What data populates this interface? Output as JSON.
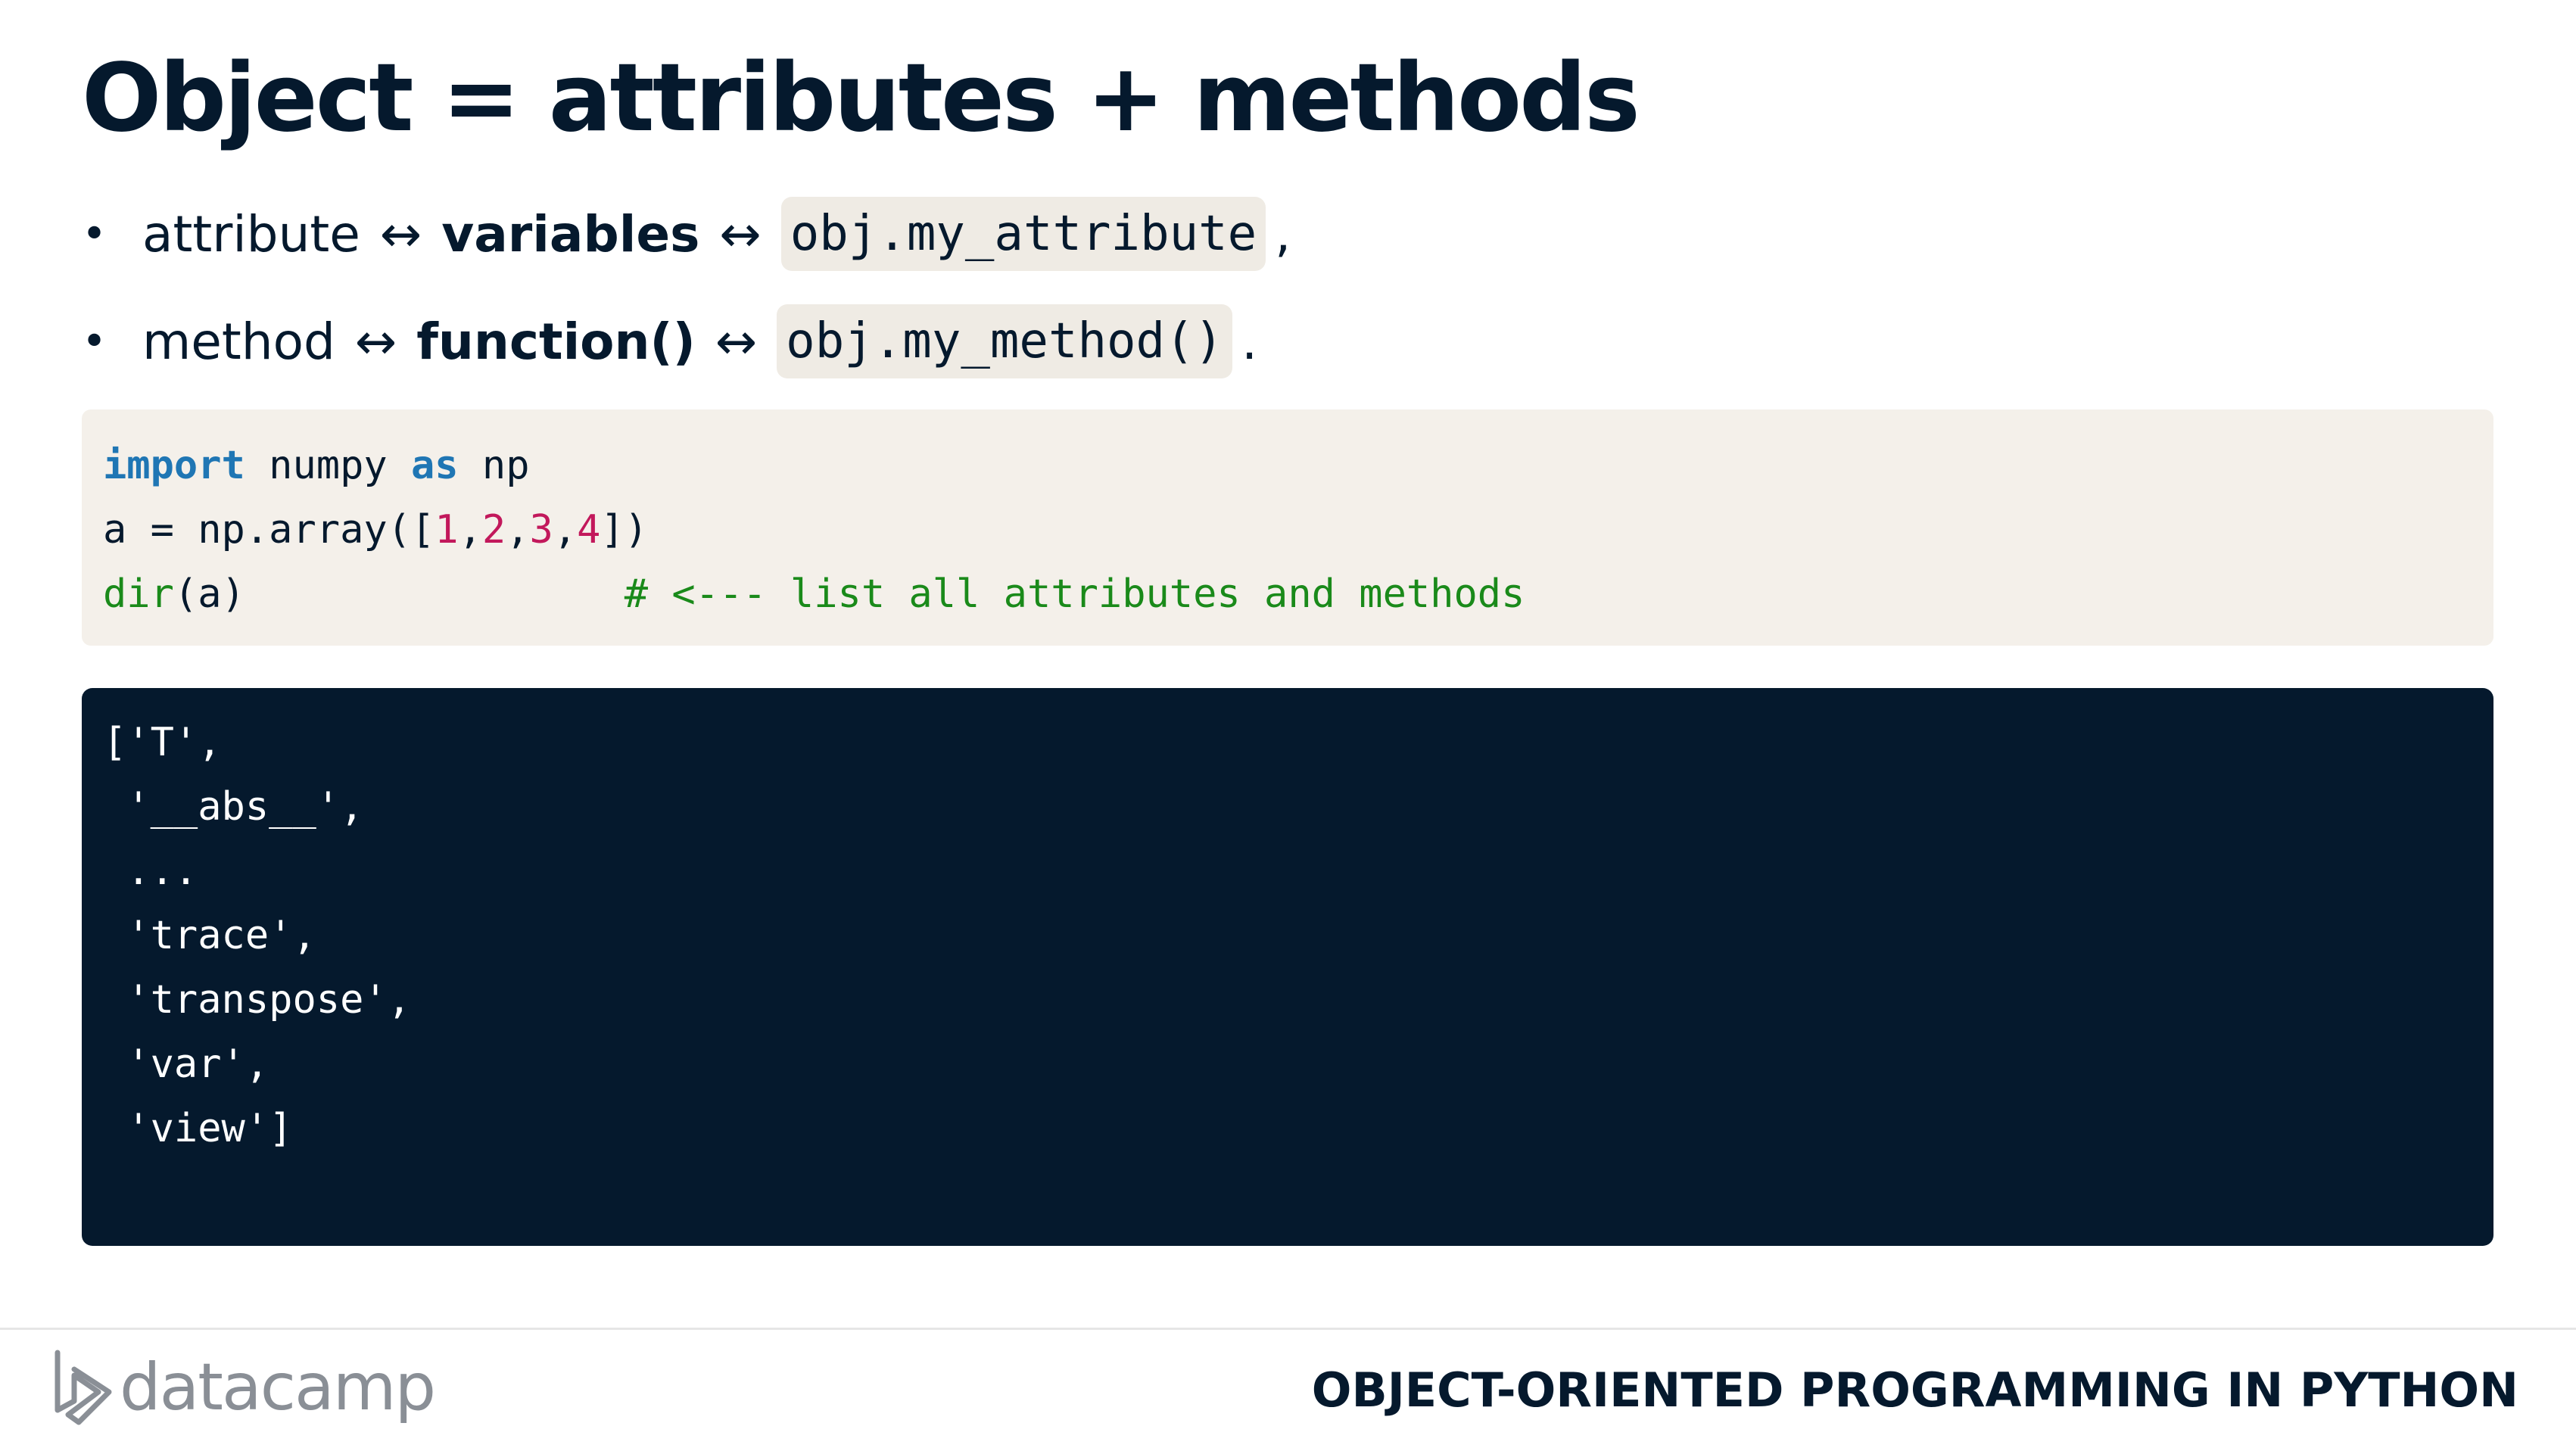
{
  "slide": {
    "title": "Object = attributes + methods"
  },
  "bullets": [
    {
      "term": "attribute",
      "arrow1": "↔",
      "bold": "variables",
      "arrow2": "↔",
      "code": "obj.my_attribute",
      "trail": ","
    },
    {
      "term": "method",
      "arrow1": "↔",
      "bold": "function()",
      "arrow2": "↔",
      "code": "obj.my_method()",
      "trail": "."
    }
  ],
  "code_input": {
    "line1": {
      "kw1": "import",
      "t1": " numpy ",
      "kw2": "as",
      "t2": " np"
    },
    "line2": {
      "p0": "a = np.array([",
      "n1": "1",
      "c1": ",",
      "n2": "2",
      "c2": ",",
      "n3": "3",
      "c3": ",",
      "n4": "4",
      "p1": "])"
    },
    "line3": {
      "fn": "dir",
      "arg": "(a)",
      "pad": "                ",
      "comment": "# <--- list all attributes and methods"
    }
  },
  "code_output": {
    "lines": [
      "['T',",
      " '__abs__',",
      " ...",
      " 'trace',",
      " 'transpose',",
      " 'var',",
      " 'view']"
    ]
  },
  "footer": {
    "logo_text": "datacamp",
    "course": "OBJECT-ORIENTED PROGRAMMING IN PYTHON"
  },
  "colors": {
    "navy": "#05192d",
    "keyword": "#1f76b4",
    "number": "#c2185b",
    "comment": "#1a8a1a",
    "code_bg": "#f4f0ea"
  }
}
